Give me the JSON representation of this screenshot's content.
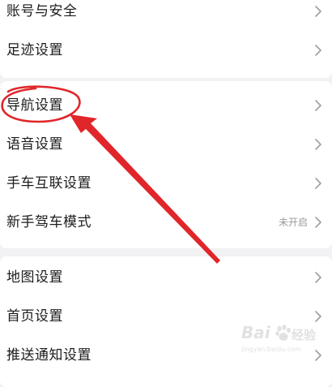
{
  "settings": {
    "group1": [
      {
        "label": "账号与安全"
      },
      {
        "label": "足迹设置"
      }
    ],
    "group2": [
      {
        "label": "导航设置"
      },
      {
        "label": "语音设置"
      },
      {
        "label": "手车互联设置"
      },
      {
        "label": "新手驾车模式",
        "value": "未开启"
      }
    ],
    "group3": [
      {
        "label": "地图设置"
      },
      {
        "label": "首页设置"
      },
      {
        "label": "推送通知设置"
      }
    ]
  },
  "annotation": {
    "color": "#e0262a"
  },
  "watermark": {
    "brand": "Bai",
    "brand_cn": "经验",
    "url": "jingyan.baidu.com"
  },
  "icons": {
    "row_chevron": "chevron-right-icon",
    "watermark_paw": "paw-icon"
  }
}
